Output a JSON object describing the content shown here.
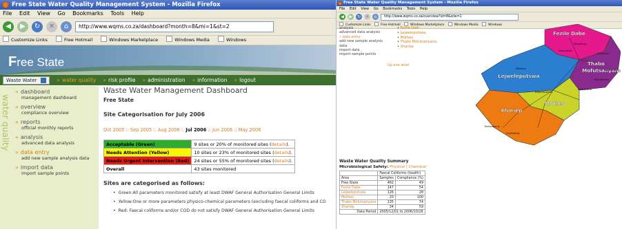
{
  "left_window": {
    "title": "Free State Water Quality Management System - Mozilla Firefox",
    "menus": [
      "File",
      "Edit",
      "View",
      "Go",
      "Bookmarks",
      "Tools",
      "Help"
    ],
    "url": "http://www.wqms.co.za/dashboard?month=8&mi=1&st=2",
    "bookmarks": [
      "Customize Links",
      "Free Hotmail",
      "Windows Marketplace",
      "Windows Media",
      "Windows"
    ],
    "logo_small": "F",
    "logo_text": "ree State",
    "nav": {
      "select": "Waste Water",
      "links": [
        "water quality",
        "risk profile",
        "administration",
        "information",
        "logout"
      ]
    },
    "sidebar": {
      "vertical": "water quality",
      "items": [
        {
          "title": "dashboard",
          "desc": "management dashboard"
        },
        {
          "title": "overview",
          "desc": "compliance overview"
        },
        {
          "title": "reports",
          "desc": "official monthly reports"
        },
        {
          "title": "analysis",
          "desc": "advanced data analysis"
        },
        {
          "title": "data entry",
          "desc": "add new sample analysis data"
        },
        {
          "title": "import data",
          "desc": "import sample points"
        }
      ]
    },
    "main": {
      "title": "Waste Water Management Dashboard",
      "region": "Free State",
      "categorisation": "Site Categorisation for July 2006",
      "months": {
        "before": "Oct 2005 :: Sep 2005 :: Aug 2006 ::",
        "current": "Jul 2006",
        "after": ":: Jun 2006 :: May 2006"
      },
      "categories": [
        {
          "label": "Acceptable (Green)",
          "text": "9 sites or 20% of monitored sites (",
          "link": "details",
          "end": ")."
        },
        {
          "label": "Needs Attention (Yellow)",
          "text": "10 sites or 23% of monitored sites (",
          "link": "details",
          "end": ")."
        },
        {
          "label": "Needs Urgent Intervention (Red)",
          "text": "24 sites or 55% of monitored sites (",
          "link": "details",
          "end": ")."
        },
        {
          "label": "Overall",
          "text": "43 sites monitored",
          "link": "",
          "end": ""
        }
      ],
      "criteria_title": "Sites are categorised as follows:",
      "criteria": [
        "Green:All parameters monitored satisfy at least DWAF General Authorisation General Limits",
        "Yellow:One or more parameters physico-chemical parameters (excluding faecal coliforms and CO",
        "Red:   Faecal coliforms and/or COD do not satisfy DWAF General Authorisation General Limits"
      ]
    }
  },
  "right_window": {
    "title": "Free State Water Quality Management System - Mozilla Firefox",
    "menus": [
      "File",
      "Edit",
      "View",
      "Go",
      "Bookmarks",
      "Tools",
      "Help"
    ],
    "url": "http://www.wqms.co.za/overview?id=8&site=1",
    "bookmarks": [
      "Customize Links",
      "Free Hotmail",
      "Windows Marketplace",
      "Windows Media",
      "Windows"
    ],
    "menu_lines": [
      "analysis",
      "advanced data analysis",
      "data entry",
      "add new sample analysis",
      "data",
      "import data",
      "import sample points"
    ],
    "sub_list": [
      "Fezile Dabi",
      "Lejweleputswa",
      "Motheo",
      "Thabo Mofutsanyana",
      "Xhariep"
    ],
    "up_level": "Up one level",
    "map": {
      "regions": [
        {
          "name": "Fezile Dabe",
          "color": "#e5198b"
        },
        {
          "name": "Thabo Mofutsanyana",
          "color": "#8a2a8e"
        },
        {
          "name": "Lejweleputswa",
          "color": "#2c7fd0"
        },
        {
          "name": "Motheo",
          "color": "#c9d32a"
        },
        {
          "name": "Xhariep",
          "color": "#ee7a12"
        }
      ],
      "towns": [
        "Sasolburg",
        "Kroonstad",
        "Frankfort",
        "Bethlehem",
        "Welkom",
        "Harrismith",
        "Bloemfontein",
        "Trompsburg",
        "Smithfield",
        "Ladybrand"
      ]
    },
    "summary": {
      "title": "Waste Water Quality Summary",
      "label": "Microbiological Safety:",
      "tabs": "Physical | Chemical",
      "header_top": "Faecal Coliforms (health)",
      "header": [
        "Area",
        "Samples",
        "Compliance (%)"
      ],
      "rows": [
        {
          "area": "Free State",
          "samples": "462",
          "compliance": "49"
        },
        {
          "area": "Fezile Dabe",
          "samples": "147",
          "compliance": "54"
        },
        {
          "area": "Lejweleputswa",
          "samples": "126",
          "compliance": "28"
        },
        {
          "area": "Motheo",
          "samples": "20",
          "compliance": "100"
        },
        {
          "area": "Thabo Mofutsanyana",
          "samples": "135",
          "compliance": "74"
        },
        {
          "area": "Xhariep",
          "samples": "34",
          "compliance": "59"
        }
      ],
      "data_period_label": "Data Period",
      "data_period": "2005/12/01 to 2006/10/28"
    }
  }
}
